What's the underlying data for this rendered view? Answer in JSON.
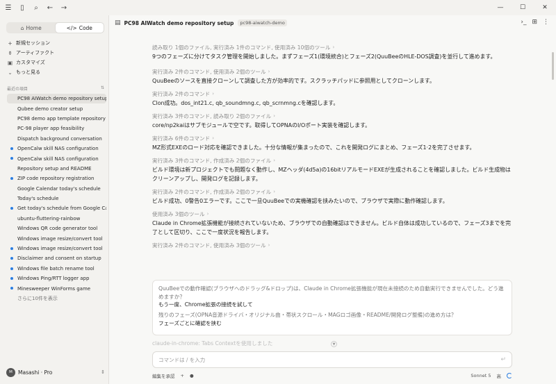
{
  "topbar": {
    "icons": [
      "menu-icon",
      "sidebar-toggle-icon",
      "search-icon",
      "back-icon",
      "forward-icon"
    ]
  },
  "window": {
    "minimize": "—",
    "maximize": "☐",
    "close": "✕"
  },
  "sidebar": {
    "tabs": [
      {
        "label": "Home",
        "icon": "home-icon"
      },
      {
        "label": "Code",
        "icon": "code-icon",
        "active": true
      }
    ],
    "nav": [
      {
        "label": "新規セッション",
        "icon": "plus-icon"
      },
      {
        "label": "アーティファクト",
        "icon": "artifact-icon"
      },
      {
        "label": "カスタマイズ",
        "icon": "customize-icon"
      },
      {
        "label": "もっと見る",
        "icon": "chevron-down-icon"
      }
    ],
    "recent_label": "最近の項目",
    "recent_filter": "⇅",
    "recent": [
      {
        "label": "PC98 AIWatch demo repository setup",
        "active": true,
        "dot": false
      },
      {
        "label": "Qubee demo creator setup",
        "dot": false
      },
      {
        "label": "PC98 demo app template repository",
        "dot": false
      },
      {
        "label": "PC-98 player app feasibility",
        "dot": false
      },
      {
        "label": "Dispatch background conversation",
        "dot": false
      },
      {
        "label": "OpenCalw skill NAS configuration",
        "dot": true
      },
      {
        "label": "OpenCalw skill NAS configuration",
        "dot": true
      },
      {
        "label": "Repository setup and README",
        "dot": false
      },
      {
        "label": "ZIP code repository registration",
        "dot": true
      },
      {
        "label": "Google Calendar today's schedule",
        "dot": false
      },
      {
        "label": "Today's schedule",
        "dot": false
      },
      {
        "label": "Get today's schedule from Google Ca",
        "dot": true
      },
      {
        "label": "ubuntu-fluttering-rainbow",
        "dot": false
      },
      {
        "label": "Windows QR code generator tool",
        "dot": false
      },
      {
        "label": "Windows image resize/convert tool",
        "dot": false
      },
      {
        "label": "Windows image resize/convert tool",
        "dot": true
      },
      {
        "label": "Disclaimer and consent on startup",
        "dot": true
      },
      {
        "label": "Windows file batch rename tool",
        "dot": true
      },
      {
        "label": "Windows Ping/RTT logger app",
        "dot": true
      },
      {
        "label": "Minesweeper WinForms game",
        "dot": true
      }
    ],
    "show_more": "さらに10件を表示",
    "user": {
      "initial": "M",
      "name": "Masashi",
      "plan": "Pro"
    }
  },
  "header": {
    "title": "PC98 AIWatch demo repository setup",
    "tag": "pc98-aiwatch-demo",
    "right_icons": [
      "terminal-icon",
      "panel-icon",
      "more-icon"
    ]
  },
  "chat": [
    {
      "kind": "tool",
      "text": "読み取り 1個のファイル, 実行済み 1件のコマンド, 使用済み 10個のツール"
    },
    {
      "kind": "msg",
      "text": "9つのフェーズに分けてタスク管理を開始しました。まずフェーズ1(環境統合)とフェーズ2(QuuBeeのHLE-DOS調査)を並行して進めます。"
    },
    {
      "kind": "tool",
      "text": "実行済み 2件のコマンド, 使用済み 2個のツール"
    },
    {
      "kind": "msg",
      "text": "QuuBeeのソースを直接クローンして調査した方が効率的です。スクラッチパッドに参照用としてクローンします。"
    },
    {
      "kind": "tool",
      "text": "実行済み 2件のコマンド"
    },
    {
      "kind": "msg",
      "text": "Clon成功。dos_int21.c, qb_soundmng.c, qb_scrnmng.cを確認します。"
    },
    {
      "kind": "tool",
      "text": "実行済み 3件のコマンド, 読み取り 2個のファイル"
    },
    {
      "kind": "msg",
      "text": "core/np2kaiはサブモジュールで空です。取得してOPNAのI/Oポート実装を確認します。"
    },
    {
      "kind": "tool",
      "text": "実行済み 6件のコマンド"
    },
    {
      "kind": "msg",
      "text": "MZ形式EXEのロード対応を確認できました。十分な情報が集まったので、これを開発ログにまとめ、フェーズ1·2を完了させます。"
    },
    {
      "kind": "tool",
      "text": "実行済み 3件のコマンド, 作成済み 2個のファイル"
    },
    {
      "kind": "msg",
      "text": "ビルド環境は新プロジェクトでも問題なく動作し、MZヘッダ(4d5a)の16bitリアルモードEXEが生成されることを確認しました。ビルド生成物はクリーンアップし、開発ログを記録します。"
    },
    {
      "kind": "tool",
      "text": "実行済み 2件のコマンド, 作成済み 2個のファイル"
    },
    {
      "kind": "msg",
      "text": "ビルド成功、0警告0エラーです。ここで一旦QuuBeeでの実機確認を挟みたいので、ブラウザで実際に動作確認します。"
    },
    {
      "kind": "tool",
      "text": "使用済み 3個のツール"
    },
    {
      "kind": "msg",
      "text": "Claude in Chrome拡張機能が接続されていないため、ブラウザでの自動確認はできません。ビルド自体は成功しているので、フェーズ3までを完了として区切り、ここで一度状況を報告します。"
    },
    {
      "kind": "tool",
      "text": "実行済み 2件のコマンド, 使用済み 3個のツール"
    }
  ],
  "question": {
    "q1": "QuuBeeでの動作確認(ブラウザへのドラッグ&ドロップ)は、Claude in Chrome拡張機能が現在未接続のため自動実行できませんでした。どう進めますか？",
    "a1": "もう一度、Chrome拡張の接続を試して",
    "q2": "残りのフェーズ(OPNA音源ドライバ・オリジナル曲・帯状スクロール・MAGロゴ画像・README/開発ログ整備)の進め方は？",
    "a2": "フェーズごとに確認を挟む"
  },
  "faded_line": "claude-in-chrome: Tabs Contextを使用しました",
  "input": {
    "placeholder": "コマンドは / を入力",
    "value": ""
  },
  "bottom": {
    "left": "編集を承認",
    "plus": "+",
    "mic": "🎙",
    "model": "Sonnet 5",
    "mode": "高"
  }
}
